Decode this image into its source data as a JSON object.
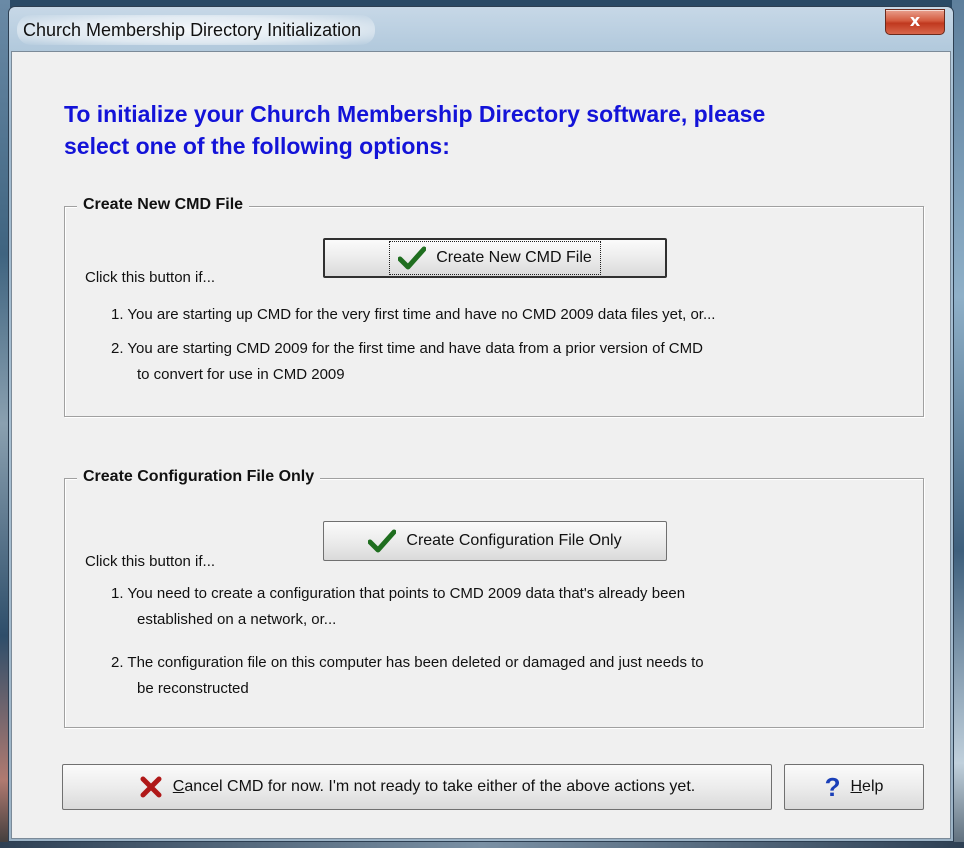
{
  "window": {
    "title": "Church Membership Directory Initialization",
    "close_label": "x"
  },
  "headline": {
    "line1": "To initialize your Church Membership Directory software, please",
    "line2": "select one of the following options:"
  },
  "group_new": {
    "title": "Create New CMD File",
    "button_label": "Create New CMD File",
    "prompt": "Click this button if...",
    "item1": "1. You are starting up CMD for the very first time and have no CMD 2009 data files yet, or...",
    "item2_line1": "2. You are starting CMD 2009 for the first time and have data from a prior version of CMD",
    "item2_line2": "to convert for use in CMD 2009"
  },
  "group_config": {
    "title": "Create Configuration File Only",
    "button_label": "Create Configuration File Only",
    "prompt": "Click this button if...",
    "item1_line1": "1. You need to create a configuration that points to CMD 2009 data that's already been",
    "item1_line2": "established on a network, or...",
    "item2_line1": "2. The configuration file on this computer has been deleted or damaged and just needs to",
    "item2_line2": "be reconstructed"
  },
  "footer": {
    "cancel_hotkey": "C",
    "cancel_rest": "ancel CMD for now. I'm not ready to take either of the above actions yet.",
    "help_hotkey": "H",
    "help_rest": "elp"
  },
  "icons": {
    "check": "checkmark-icon",
    "cancel": "red-x-icon",
    "help": "question-mark-icon"
  },
  "colors": {
    "headline": "#1313d8",
    "check_green": "#1f6e1f",
    "cancel_red": "#b01818",
    "help_blue": "#1a3fb8"
  }
}
